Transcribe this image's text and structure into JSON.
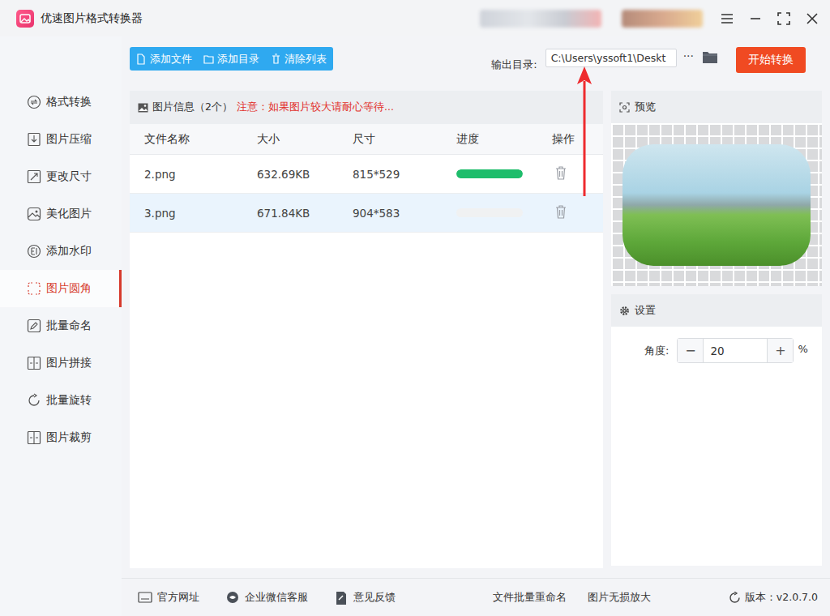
{
  "window": {
    "title": "优速图片格式转换器"
  },
  "sidebar": {
    "items": [
      {
        "label": "格式转换",
        "selected": false
      },
      {
        "label": "图片压缩",
        "selected": false
      },
      {
        "label": "更改尺寸",
        "selected": false
      },
      {
        "label": "美化图片",
        "selected": false
      },
      {
        "label": "添加水印",
        "selected": false
      },
      {
        "label": "图片圆角",
        "selected": true
      },
      {
        "label": "批量命名",
        "selected": false
      },
      {
        "label": "图片拼接",
        "selected": false
      },
      {
        "label": "批量旋转",
        "selected": false
      },
      {
        "label": "图片裁剪",
        "selected": false
      }
    ]
  },
  "toolbar": {
    "buttons": [
      "添加文件",
      "添加目录",
      "清除列表"
    ],
    "output_label": "输出目录:",
    "output_path": "C:\\Users\\yssoft1\\Deskt",
    "more": "···",
    "start": "开始转换"
  },
  "file_panel": {
    "title": "图片信息（2个）",
    "note": "注意：如果图片较大请耐心等待..."
  },
  "table": {
    "columns": [
      "文件名称",
      "大小",
      "尺寸",
      "进度",
      "操作"
    ],
    "rows": [
      {
        "cells": [
          "2.png",
          "632.69KB",
          "815*529"
        ],
        "level": 1,
        "selected": false
      },
      {
        "cells": [
          "3.png",
          "671.84KB",
          "904*583"
        ],
        "level": 0,
        "selected": true
      }
    ]
  },
  "preview": {
    "title": "预览"
  },
  "settings": {
    "title": "设置",
    "label": "角度:",
    "minus": "−",
    "value": "20",
    "plus": "+",
    "unit": "%"
  },
  "status_bar": {
    "links": [
      "官方网址",
      "企业微信客服",
      "意见反馈"
    ],
    "right_links": [
      "文件批量重命名",
      "图片无损放大"
    ],
    "version": "版本：v2.0.7.0"
  }
}
